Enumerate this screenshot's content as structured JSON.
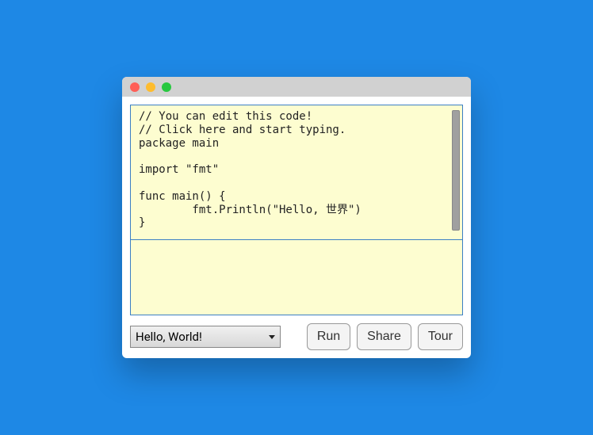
{
  "window": {
    "titlebar": {
      "lights": [
        "close",
        "minimize",
        "zoom"
      ]
    }
  },
  "editor": {
    "code": "// You can edit this code!\n// Click here and start typing.\npackage main\n\nimport \"fmt\"\n\nfunc main() {\n        fmt.Println(\"Hello, 世界\")\n}",
    "output": ""
  },
  "controls": {
    "selector": {
      "selected": "Hello, World!"
    },
    "buttons": {
      "run": "Run",
      "share": "Share",
      "tour": "Tour"
    }
  }
}
